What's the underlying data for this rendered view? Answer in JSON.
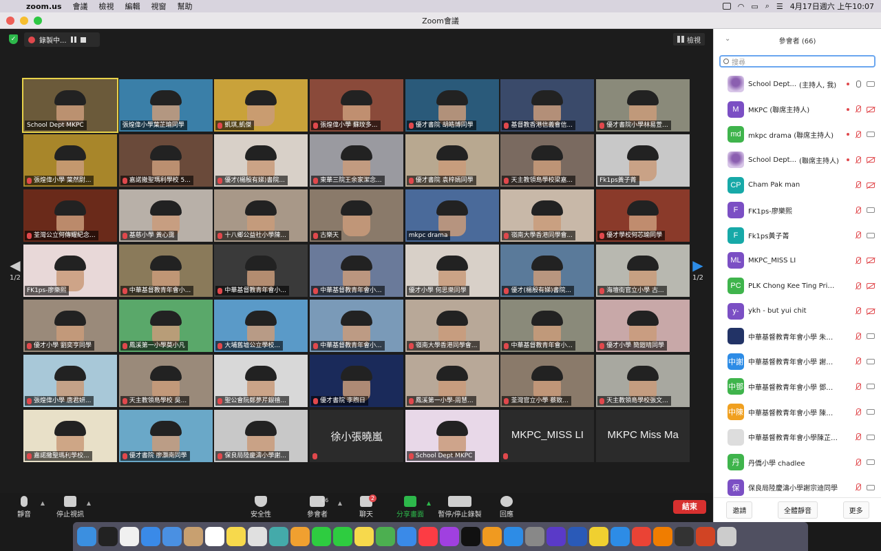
{
  "menubar": {
    "app": "zoom.us",
    "items": [
      "會議",
      "檢視",
      "編輯",
      "視窗",
      "幫助"
    ],
    "datetime": "4月17日週六 上午10:07"
  },
  "window": {
    "title": "Zoom會議"
  },
  "meeting": {
    "recording_label": "錄製中...",
    "view_label": "檢視",
    "page_indicator": "1/2"
  },
  "tiles": [
    {
      "name": "School Dept MKPC",
      "bg": "#6b5a3a",
      "muted": false,
      "active": true
    },
    {
      "name": "張煌偉小學葉芷瑜同學",
      "bg": "#3a7fa8",
      "muted": false
    },
    {
      "name": "凱琪,凱傑",
      "bg": "#c9a23a",
      "muted": true
    },
    {
      "name": "張煌偉小學 蘇玟多...",
      "bg": "#8a4a3a",
      "muted": true
    },
    {
      "name": "優才書院 胡皓博同學",
      "bg": "#2a5a7a",
      "muted": true
    },
    {
      "name": "基督教香港信義會信...",
      "bg": "#3a4a6a",
      "muted": true
    },
    {
      "name": "優才書院小學林易萱...",
      "bg": "#8a8a7a",
      "muted": true
    },
    {
      "name": "張煌偉小學 葉然尉...",
      "bg": "#a8862a",
      "muted": true
    },
    {
      "name": "嘉諾撒聖瑪利學校 5...",
      "bg": "#6a4a3a",
      "muted": true
    },
    {
      "name": "優才(楊殷有娣)書院...",
      "bg": "#d8d0c8",
      "muted": true
    },
    {
      "name": "東華三院王余家潔念...",
      "bg": "#9a9aa0",
      "muted": true
    },
    {
      "name": "優才書院 袁梓嫣同學",
      "bg": "#b8a890",
      "muted": true
    },
    {
      "name": "天主教領島學校梁嘉...",
      "bg": "#7a6a60",
      "muted": true
    },
    {
      "name": "Fk1ps黃子菁",
      "bg": "#c8c8c8",
      "muted": false
    },
    {
      "name": "荃灣公立何傳耀紀念...",
      "bg": "#6a2a1a",
      "muted": true
    },
    {
      "name": "基慈小學 黃心靄",
      "bg": "#b8b0a8",
      "muted": true
    },
    {
      "name": "十八鄉公益社小學陳...",
      "bg": "#a89888",
      "muted": true
    },
    {
      "name": "古樂天",
      "bg": "#8a7a6a",
      "muted": true
    },
    {
      "name": "mkpc drama",
      "bg": "#4a6a9a",
      "muted": false
    },
    {
      "name": "嶺南大學香港同學會...",
      "bg": "#c8b8a8",
      "muted": true
    },
    {
      "name": "優才學校何芯瑜同學",
      "bg": "#8a3a2a",
      "muted": true
    },
    {
      "name": "FK1ps-廖樂熙",
      "bg": "#e8d8d8",
      "muted": false
    },
    {
      "name": "中華基督教青年會小...",
      "bg": "#8a7a5a",
      "muted": true
    },
    {
      "name": "中華基督教青年會小...",
      "bg": "#3a3a3a",
      "muted": true
    },
    {
      "name": "中華基督教青年會小...",
      "bg": "#6a7a9a",
      "muted": true
    },
    {
      "name": "優才小學 何思樂同學",
      "bg": "#d8d0c8",
      "muted": false
    },
    {
      "name": "優才(楊殷有娣)書院...",
      "bg": "#5a7a9a",
      "muted": true
    },
    {
      "name": "海壇街官立小學 古...",
      "bg": "#b8b8b0",
      "muted": true
    },
    {
      "name": "優才小學 劉奕亨同學",
      "bg": "#9a8a7a",
      "muted": true
    },
    {
      "name": "鳳溪第一小學莫小凡",
      "bg": "#5aa86a",
      "muted": true
    },
    {
      "name": "大埔舊墟公立學校...",
      "bg": "#5a9ac8",
      "muted": true
    },
    {
      "name": "中華基督教青年會小...",
      "bg": "#7a9ab8",
      "muted": true
    },
    {
      "name": "嶺南大學香港同學會...",
      "bg": "#b8a898",
      "muted": true
    },
    {
      "name": "中華基督教青年會小...",
      "bg": "#8a8a7a",
      "muted": true
    },
    {
      "name": "優才小學 簡鎧晴同學",
      "bg": "#c8a8a8",
      "muted": true
    },
    {
      "name": "張煌偉小學 唐君妍...",
      "bg": "#a8c8d8",
      "muted": true
    },
    {
      "name": "天主教領島學校 吳...",
      "bg": "#9a8a7a",
      "muted": true
    },
    {
      "name": "聖公會阮鄭夢芹銀禧...",
      "bg": "#d8d8d8",
      "muted": true
    },
    {
      "name": "優才書院 李煦日",
      "bg": "#1a2a5a",
      "muted": true
    },
    {
      "name": "鳳溪第一小學-周慧...",
      "bg": "#b8a898",
      "muted": true
    },
    {
      "name": "荃灣官立小學 蔡致...",
      "bg": "#8a7a6a",
      "muted": true
    },
    {
      "name": "天主教領島學校張文...",
      "bg": "#a8a8a0",
      "muted": true
    },
    {
      "name": "嘉諾撒聖瑪利學校...",
      "bg": "#e8e0c8",
      "muted": true
    },
    {
      "name": "優才書院 廖灝南同學",
      "bg": "#6aa8c8",
      "muted": true
    },
    {
      "name": "保良局陸慶濤小學謝...",
      "bg": "#c8c8c8",
      "muted": true
    },
    {
      "name": "",
      "bg": "#2b2b2b",
      "muted": true,
      "bigname": "徐小張曉嵐"
    },
    {
      "name": "School Dept MKPC",
      "bg": "#e8d8e8",
      "muted": true
    },
    {
      "name": "",
      "bg": "#2b2b2b",
      "muted": true,
      "bigname": "MKPC_MISS LI"
    },
    {
      "name": "",
      "bg": "#2b2b2b",
      "muted": false,
      "bigname": "MKPC Miss Ma"
    }
  ],
  "toolbar": {
    "mute": "靜音",
    "stop_video": "停止視訊",
    "security": "安全性",
    "participants": "參會者",
    "participants_count": "66",
    "chat": "聊天",
    "chat_badge": "2",
    "share": "分享畫面",
    "record": "暫停/停止錄製",
    "reactions": "回應",
    "end": "結束"
  },
  "sidebar": {
    "title": "參會者 (66)",
    "search_placeholder": "搜尋",
    "participants": [
      {
        "avatar": "",
        "avatar_color": "",
        "name": "School Dept...",
        "role": "(主持人, 我)",
        "mic_on": true,
        "cam_on": true,
        "rec": true
      },
      {
        "avatar": "M",
        "avatar_color": "#7b4fc4",
        "name": "MKPC (聯席主持人)",
        "role": "",
        "mic_on": false,
        "cam_on": false,
        "rec": true
      },
      {
        "avatar": "md",
        "avatar_color": "#3fb44c",
        "name": "mkpc drama (聯席主持人)",
        "role": "",
        "mic_on": false,
        "cam_on": true,
        "rec": true
      },
      {
        "avatar": "",
        "avatar_color": "",
        "name": "School Dept...",
        "role": "(聯席主持人)",
        "mic_on": false,
        "cam_on": false,
        "rec": true
      },
      {
        "avatar": "CP",
        "avatar_color": "#17a9a8",
        "name": "Cham Pak man",
        "role": "",
        "mic_on": false,
        "cam_on": false,
        "rec": false
      },
      {
        "avatar": "F",
        "avatar_color": "#7b4fc4",
        "name": "FK1ps-廖樂熙",
        "role": "",
        "mic_on": false,
        "cam_on": true,
        "rec": false
      },
      {
        "avatar": "F",
        "avatar_color": "#17a9a8",
        "name": "Fk1ps黃子菁",
        "role": "",
        "mic_on": false,
        "cam_on": true,
        "rec": false
      },
      {
        "avatar": "ML",
        "avatar_color": "#7b4fc4",
        "name": "MKPC_MISS LI",
        "role": "",
        "mic_on": false,
        "cam_on": false,
        "rec": false
      },
      {
        "avatar": "PC",
        "avatar_color": "#3fb44c",
        "name": "PLK Chong Kee Ting Primary...",
        "role": "",
        "mic_on": false,
        "cam_on": false,
        "rec": false
      },
      {
        "avatar": "y-",
        "avatar_color": "#7b4fc4",
        "name": "ykh - but yui chit",
        "role": "",
        "mic_on": false,
        "cam_on": false,
        "rec": false
      },
      {
        "avatar": "",
        "avatar_color": "#223366",
        "name": "中華基督教青年會小學 朱梓...",
        "role": "",
        "mic_on": false,
        "cam_on": true,
        "rec": false
      },
      {
        "avatar": "中謝",
        "avatar_color": "#2d8ce6",
        "name": "中華基督教青年會小學 謝家...",
        "role": "",
        "mic_on": false,
        "cam_on": true,
        "rec": false
      },
      {
        "avatar": "中鄧",
        "avatar_color": "#3fb44c",
        "name": "中華基督教青年會小學 鄧瑞...",
        "role": "",
        "mic_on": false,
        "cam_on": true,
        "rec": false
      },
      {
        "avatar": "中陳",
        "avatar_color": "#f0a020",
        "name": "中華基督教青年會小學 陳家...",
        "role": "",
        "mic_on": false,
        "cam_on": true,
        "rec": false
      },
      {
        "avatar": "",
        "avatar_color": "#dddddd",
        "name": "中華基督教青年會小學陳芷晴...",
        "role": "",
        "mic_on": false,
        "cam_on": true,
        "rec": false
      },
      {
        "avatar": "丹",
        "avatar_color": "#3fb44c",
        "name": "丹僑小學 chadlee",
        "role": "",
        "mic_on": false,
        "cam_on": true,
        "rec": false
      },
      {
        "avatar": "保",
        "avatar_color": "#7b4fc4",
        "name": "保良局陸慶濤小學謝宗迪同學",
        "role": "",
        "mic_on": false,
        "cam_on": true,
        "rec": false
      }
    ],
    "invite": "邀請",
    "mute_all": "全體靜音",
    "more": "更多"
  },
  "dock_colors": [
    "#3b8fe0",
    "#222",
    "#f0f0f0",
    "#3a8ae8",
    "#4a90e2",
    "#c8a070",
    "#ffffff",
    "#f7d94c",
    "#e0e0e0",
    "#4aa",
    "#f0a030",
    "#2ecc40",
    "#2ecc40",
    "#f7d94c",
    "#4caf50",
    "#3a8ae8",
    "#fc3c44",
    "#a040e0",
    "#111",
    "#f09a20",
    "#2d8ce6",
    "#888",
    "#5a3ac8",
    "#2a5ab8",
    "#f0d030",
    "#2d8ce6",
    "#ea4335",
    "#f07d00",
    "#333",
    "#d14424",
    "#cccccc"
  ]
}
